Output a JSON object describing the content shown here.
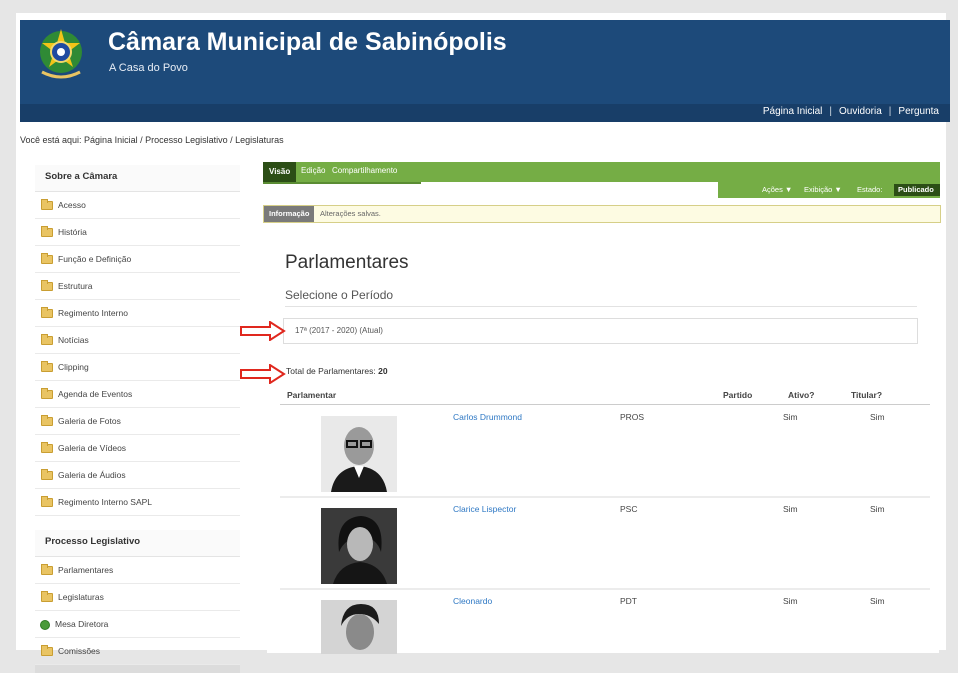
{
  "header": {
    "title": "Câmara Municipal de Sabinópolis",
    "subtitle": "A Casa do Povo",
    "logo_icon": "coat-of-arms-icon"
  },
  "nav": {
    "links": [
      "Página Inicial",
      "Ouvidoria",
      "Pergunta"
    ]
  },
  "breadcrumb": "Você está aqui: Página Inicial / Processo Legislativo / Legislaturas",
  "sidebar": {
    "section1_title": "Sobre a Câmara",
    "section1_items": [
      "Acesso",
      "História",
      "Função e Definição",
      "Estrutura",
      "Regimento Interno",
      "Notícias",
      "Clipping",
      "Agenda de Eventos",
      "Galeria de Fotos",
      "Galeria de Vídeos",
      "Galeria de Áudios",
      "Regimento Interno SAPL"
    ],
    "section2_title": "Processo Legislativo",
    "section2_items": [
      "Parlamentares",
      "Legislaturas",
      "Mesa Diretora",
      "Comissões"
    ]
  },
  "tabs": [
    "Visão",
    "Edição",
    "Compartilhamento"
  ],
  "actions": {
    "acoes": "Ações ▼",
    "exibicao": "Exibição ▼",
    "estado_label": "Estado:",
    "estado_value": "Publicado ▼"
  },
  "info": {
    "label": "Informação",
    "text": "Alterações salvas."
  },
  "main": {
    "title": "Parlamentares",
    "select_label": "Selecione o Período",
    "period": "17ª (2017 - 2020) (Atual)",
    "total_label": "Total de Parlamentares:",
    "total_value": "20"
  },
  "table": {
    "headers": {
      "parlamentar": "Parlamentar",
      "partido": "Partido",
      "ativo": "Ativo?",
      "titular": "Titular?"
    },
    "rows": [
      {
        "name": "Carlos Drummond",
        "party": "PROS",
        "ativo": "Sim",
        "titular": "Sim"
      },
      {
        "name": "Clarice Lispector",
        "party": "PSC",
        "ativo": "Sim",
        "titular": "Sim"
      },
      {
        "name": "Cleonardo",
        "party": "PDT",
        "ativo": "Sim",
        "titular": "Sim"
      }
    ]
  },
  "colors": {
    "header_blue": "#1d4a7a",
    "nav_blue": "#183e68",
    "tab_green": "#75ad45",
    "tab_active": "#2c4e16",
    "link_blue": "#2e78c4",
    "arrow_red": "#e0281e"
  }
}
